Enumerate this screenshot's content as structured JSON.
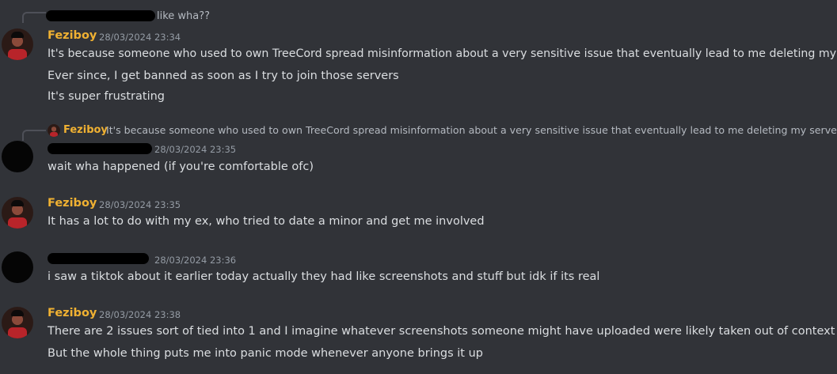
{
  "messages": {
    "m1": {
      "reply_snippet": "like wha??",
      "username": "Feziboy",
      "timestamp": "28/03/2024 23:34",
      "lines": [
        "It's because someone who used to own TreeCord spread misinformation about a very sensitive issue that eventually lead to me deleting my server",
        "Ever since, I get banned as soon as I try to join those servers",
        "It's super frustrating"
      ]
    },
    "m2": {
      "reply_username": "Feziboy",
      "reply_snippet": "It's because someone who used to own TreeCord spread misinformation about a very sensitive issue that eventually lead to me deleting my server",
      "timestamp": "28/03/2024 23:35",
      "lines": [
        "wait wha happened (if you're comfortable ofc)"
      ]
    },
    "m3": {
      "username": "Feziboy",
      "timestamp": "28/03/2024 23:35",
      "lines": [
        "It has a lot to do with my ex, who tried to date a minor and get me involved"
      ]
    },
    "m4": {
      "timestamp": "28/03/2024 23:36",
      "lines": [
        "i saw a tiktok about it earlier today actually they had like screenshots and stuff but idk if its real"
      ]
    },
    "m5": {
      "username": "Feziboy",
      "timestamp": "28/03/2024 23:38",
      "lines": [
        "There are 2 issues sort of tied into 1 and I imagine whatever screenshots someone might have uploaded were likely taken out of context idk",
        "But the whole thing puts me into panic mode whenever anyone brings it up"
      ]
    }
  }
}
